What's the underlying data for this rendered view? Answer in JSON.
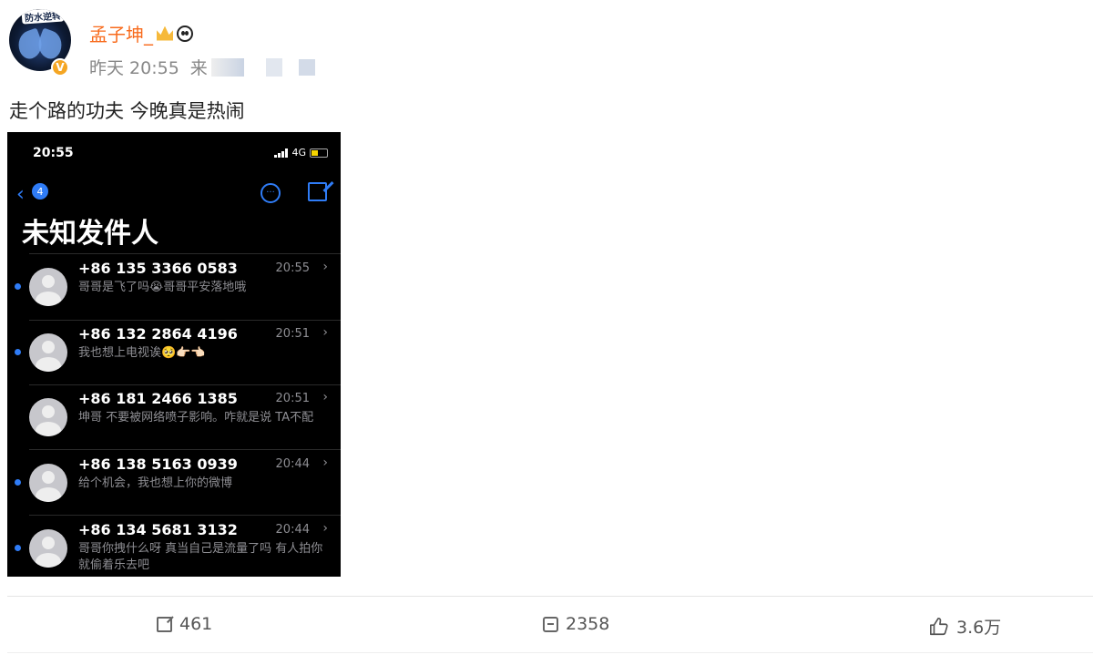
{
  "post": {
    "avatar_sticker": "防水逆转",
    "verified_badge": "V",
    "username": "孟子坤_",
    "time": "昨天 20:55",
    "source_prefix": "来",
    "text": "走个路的功夫 今晚真是热闹"
  },
  "screenshot": {
    "status_time": "20:55",
    "network": "4G",
    "back_count": "4",
    "more_icon_glyph": "···",
    "title": "未知发件人",
    "messages": [
      {
        "number": "+86 135 3366 0583",
        "time": "20:55",
        "preview": "哥哥是飞了吗😭哥哥平安落地哦"
      },
      {
        "number": "+86 132 2864 4196",
        "time": "20:51",
        "preview": "我也想上电视诶🥺👉🏻👈🏻"
      },
      {
        "number": "+86 181 2466 1385",
        "time": "20:51",
        "preview": "坤哥 不要被网络喷子影响。咋就是说 TA不配"
      },
      {
        "number": "+86 138 5163 0939",
        "time": "20:44",
        "preview": "给个机会，我也想上你的微博"
      },
      {
        "number": "+86 134 5681 3132",
        "time": "20:44",
        "preview": "哥哥你拽什么呀 真当自己是流量了吗 有人拍你就偷着乐去吧"
      }
    ]
  },
  "actions": {
    "repost_count": "461",
    "comment_count": "2358",
    "like_count": "3.6万"
  },
  "icons": {
    "repost": "repost-icon",
    "comment": "comment-icon",
    "like": "like-icon",
    "back": "chevron-left-icon",
    "more": "more-icon",
    "compose": "compose-icon"
  },
  "colors": {
    "username": "#f86b1d",
    "ios_blue": "#2f7cf6",
    "verified": "#f5a623"
  }
}
